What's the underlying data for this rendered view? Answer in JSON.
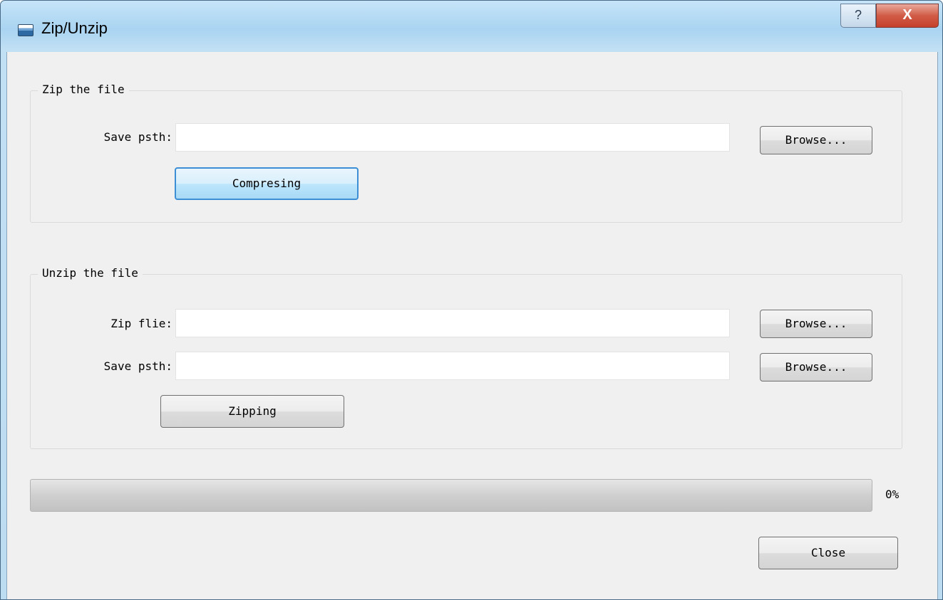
{
  "window": {
    "title": "Zip/Unzip",
    "help_glyph": "?",
    "close_glyph": "X",
    "icon": "app-window-icon"
  },
  "zip_group": {
    "title": "Zip the file",
    "save_path_label": "Save psth:",
    "save_path_value": "",
    "browse_label": "Browse...",
    "action_label": "Compresing"
  },
  "unzip_group": {
    "title": "Unzip the file",
    "zip_file_label": "Zip flie:",
    "zip_file_value": "",
    "save_path_label": "Save psth:",
    "save_path_value": "",
    "browse_zip_label": "Browse...",
    "browse_save_label": "Browse...",
    "action_label": "Zipping"
  },
  "progress": {
    "value_percent": 0,
    "label": "0%"
  },
  "footer": {
    "close_label": "Close"
  },
  "colors": {
    "title_bar": "#a9d4f1",
    "close_button": "#c5402c",
    "client_bg": "#f0f0f0",
    "focus_border": "#3c8fd4"
  }
}
